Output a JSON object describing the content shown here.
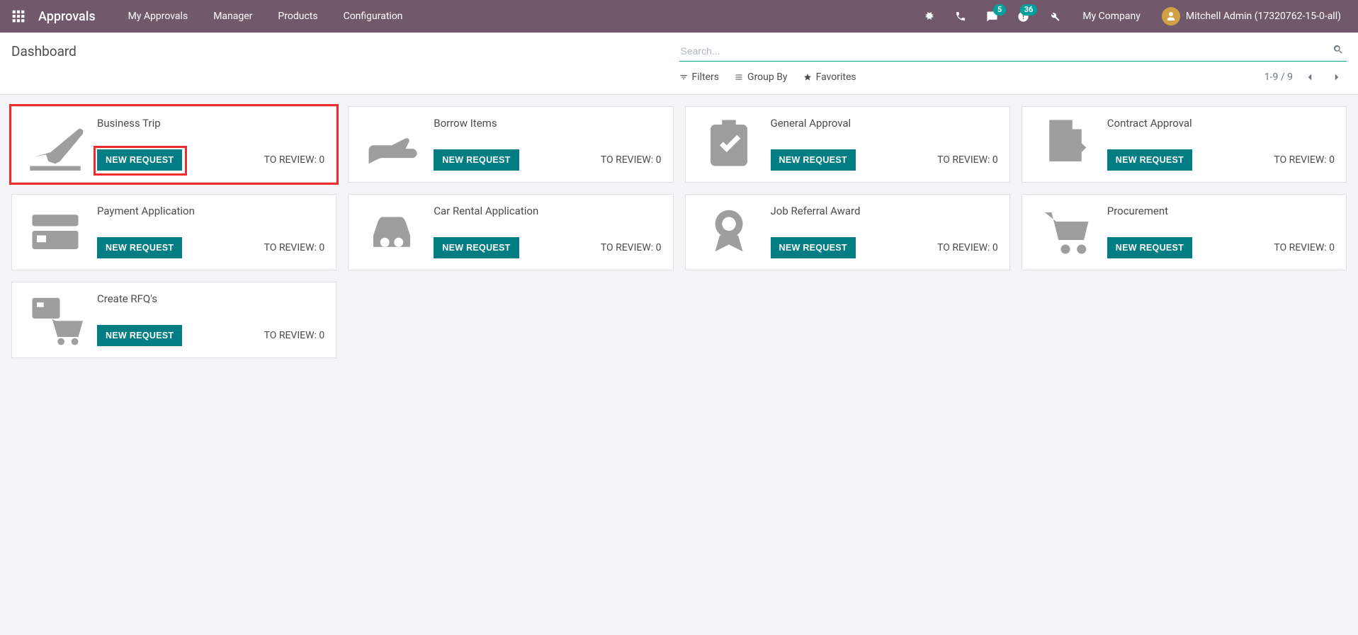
{
  "nav": {
    "brand": "Approvals",
    "links": [
      "My Approvals",
      "Manager",
      "Products",
      "Configuration"
    ],
    "messages_badge": "5",
    "activities_badge": "36",
    "company": "My Company",
    "user_name": "Mitchell Admin (17320762-15-0-all)"
  },
  "control": {
    "title": "Dashboard",
    "search_placeholder": "Search...",
    "filters_label": "Filters",
    "group_by_label": "Group By",
    "favorites_label": "Favorites",
    "pager": "1-9 / 9"
  },
  "labels": {
    "new_request": "NEW REQUEST",
    "to_review_prefix": "TO REVIEW: "
  },
  "cards": [
    {
      "title": "Business Trip",
      "review": 0,
      "icon": "plane",
      "highlight": true
    },
    {
      "title": "Borrow Items",
      "review": 0,
      "icon": "hand"
    },
    {
      "title": "General Approval",
      "review": 0,
      "icon": "clipboard"
    },
    {
      "title": "Contract Approval",
      "review": 0,
      "icon": "sign"
    },
    {
      "title": "Payment Application",
      "review": 0,
      "icon": "card"
    },
    {
      "title": "Car Rental Application",
      "review": 0,
      "icon": "car"
    },
    {
      "title": "Job Referral Award",
      "review": 0,
      "icon": "award"
    },
    {
      "title": "Procurement",
      "review": 0,
      "icon": "cart"
    },
    {
      "title": "Create RFQ's",
      "review": 0,
      "icon": "rfq"
    }
  ]
}
